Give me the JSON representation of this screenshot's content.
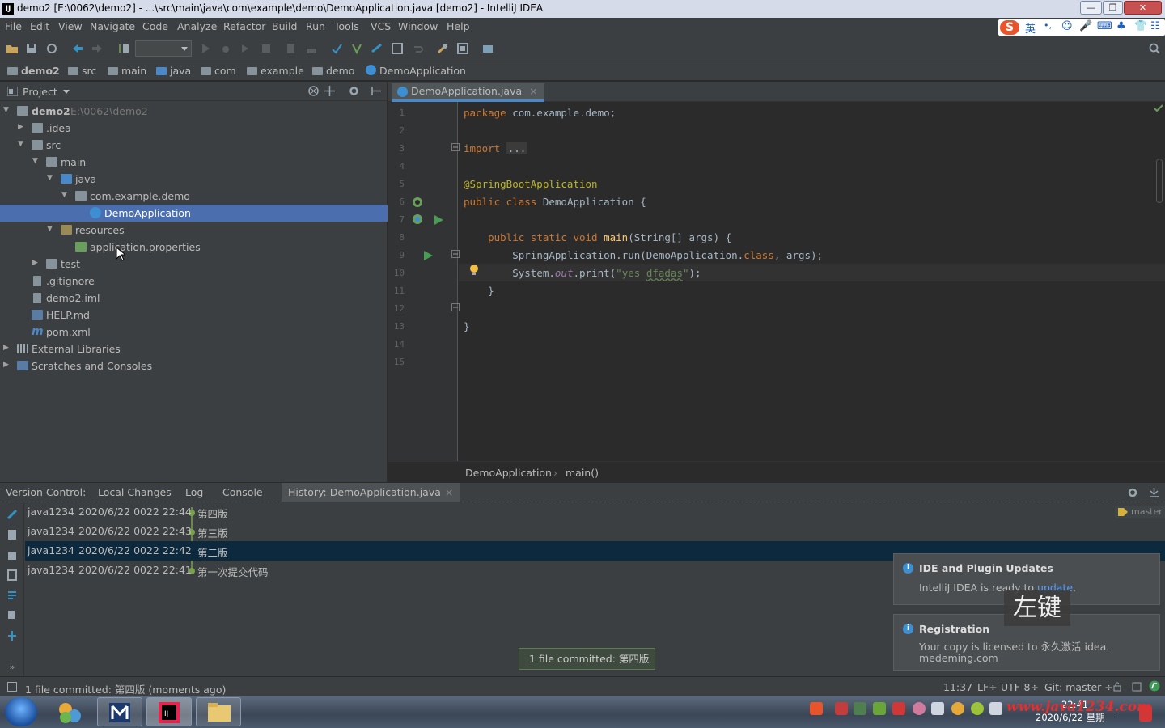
{
  "window": {
    "title": "demo2 [E:\\0062\\demo2] - ...\\src\\main\\java\\com\\example\\demo\\DemoApplication.java [demo2] - IntelliJ IDEA",
    "app_icon": "IJ",
    "controls": [
      "—",
      "❐",
      "✕"
    ]
  },
  "menu": [
    "File",
    "Edit",
    "View",
    "Navigate",
    "Code",
    "Analyze",
    "Refactor",
    "Build",
    "Run",
    "Tools",
    "VCS",
    "Window",
    "Help"
  ],
  "ime_bar": {
    "logo": "S",
    "lang": "英",
    "items": [
      "•,",
      "☺",
      "🎤",
      "⌨",
      "♣",
      "👕",
      "☷"
    ]
  },
  "breadcrumb": [
    "demo2",
    "src",
    "main",
    "java",
    "com",
    "example",
    "demo",
    "DemoApplication"
  ],
  "project_panel": {
    "title": "Project",
    "tree": [
      {
        "label": "demo2",
        "extra": "E:\\0062\\demo2",
        "bold": true
      },
      {
        "label": ".idea"
      },
      {
        "label": "src"
      },
      {
        "label": "main"
      },
      {
        "label": "java"
      },
      {
        "label": "com.example.demo"
      },
      {
        "label": "DemoApplication",
        "selected": true
      },
      {
        "label": "resources"
      },
      {
        "label": "application.properties"
      },
      {
        "label": "test"
      },
      {
        "label": ".gitignore"
      },
      {
        "label": "demo2.iml"
      },
      {
        "label": "HELP.md"
      },
      {
        "label": "pom.xml"
      },
      {
        "label": "External Libraries"
      },
      {
        "label": "Scratches and Consoles"
      }
    ]
  },
  "editor": {
    "tab": "DemoApplication.java",
    "line_numbers": [
      "1",
      "2",
      "3",
      "4",
      "5",
      "6",
      "7",
      "8",
      "9",
      "10",
      "11",
      "12",
      "13",
      "14",
      "15"
    ],
    "code": {
      "l1_kw": "package",
      "l1_rest": " com.example.demo;",
      "l3_kw": "import",
      "l3_fold": "...",
      "l6_ann": "@SpringBootApplication",
      "l7_kw": "public class",
      "l7_rest": " DemoApplication {",
      "l9_kw": "public static void",
      "l9_fn": "main",
      "l9_rest": "(String[] args) {",
      "l10_a": "SpringApplication.run(DemoApplication.",
      "l10_kw": "class",
      "l10_b": ", args);",
      "l11_a": "System.",
      "l11_fld": "out",
      "l11_b": ".print(",
      "l11_str1": "\"yes ",
      "l11_typo": "dfadas",
      "l11_str2": "\"",
      "l11_c": ");",
      "l12": "}",
      "l14": "}"
    },
    "crumb": [
      "DemoApplication",
      "main()"
    ]
  },
  "version_control": {
    "label": "Version Control:",
    "tabs": [
      "Local Changes",
      "Log",
      "Console",
      "History: DemoApplication.java"
    ],
    "branch_tag": "master",
    "history": [
      {
        "author": "java1234",
        "date": "2020/6/22 0022 22:44",
        "message": "第四版"
      },
      {
        "author": "java1234",
        "date": "2020/6/22 0022 22:43",
        "message": "第三版"
      },
      {
        "author": "java1234",
        "date": "2020/6/22 0022 22:42",
        "message": "第二版",
        "selected": true
      },
      {
        "author": "java1234",
        "date": "2020/6/22 0022 22:41",
        "message": "第一次提交代码"
      }
    ]
  },
  "notifications": [
    {
      "title": "IDE and Plugin Updates",
      "body_prefix": "IntelliJ IDEA is ready to ",
      "link": "update",
      "body_suffix": "."
    },
    {
      "title": "Registration",
      "line1": "Your copy is licensed to 永久激活 idea.",
      "line2": "medeming.com"
    }
  ],
  "balloon": "1 file committed: 第四版",
  "overlay_key": "左键",
  "status": {
    "message": "1 file committed: 第四版 (moments ago)",
    "position": "11:37",
    "line_sep": "LF÷",
    "encoding": "UTF-8÷",
    "vcs": "Git: master ÷"
  },
  "taskbar": {
    "time": "22:41",
    "date": "2020/6/22 星期一",
    "watermark": "www.java1234.com"
  },
  "colors": {
    "selection": "#4b6eaf",
    "log_selection": "#0d293e",
    "keyword": "#cc7832",
    "annotation": "#bbb529",
    "string": "#6a8759"
  }
}
